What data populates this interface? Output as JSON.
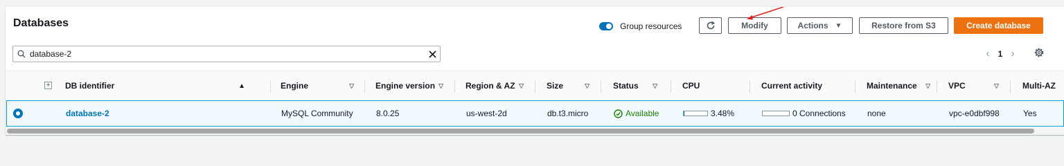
{
  "header": {
    "title": "Databases",
    "group_toggle_label": "Group resources",
    "group_toggle_on": true,
    "buttons": {
      "modify": "Modify",
      "actions": "Actions",
      "restore": "Restore from S3",
      "create": "Create database"
    }
  },
  "search": {
    "value": "database-2"
  },
  "pagination": {
    "current_page": "1"
  },
  "table": {
    "columns": {
      "db_identifier": "DB identifier",
      "engine": "Engine",
      "engine_version": "Engine version",
      "region_az": "Region & AZ",
      "size": "Size",
      "status": "Status",
      "cpu": "CPU",
      "current_activity": "Current activity",
      "maintenance": "Maintenance",
      "vpc": "VPC",
      "multi_az": "Multi-AZ"
    },
    "row": {
      "db_identifier": "database-2",
      "engine": "MySQL Community",
      "engine_version": "8.0.25",
      "region_az": "us-west-2d",
      "size": "db.t3.micro",
      "status": "Available",
      "cpu_text": "3.48%",
      "cpu_fraction": 0.0348,
      "current_activity": "0 Connections",
      "connections_fraction": 0,
      "maintenance": "none",
      "vpc": "vpc-e0dbf998",
      "multi_az": "Yes"
    }
  },
  "colors": {
    "primary": "#ec7211",
    "link": "#0073bb",
    "status_ok": "#1d8102",
    "annotation_arrow": "#e02020"
  },
  "icons": [
    "search-icon",
    "clear-icon",
    "refresh-icon",
    "caret-down-icon",
    "chevron-left-icon",
    "chevron-right-icon",
    "settings-icon",
    "check-circle-icon",
    "expand-icon"
  ]
}
